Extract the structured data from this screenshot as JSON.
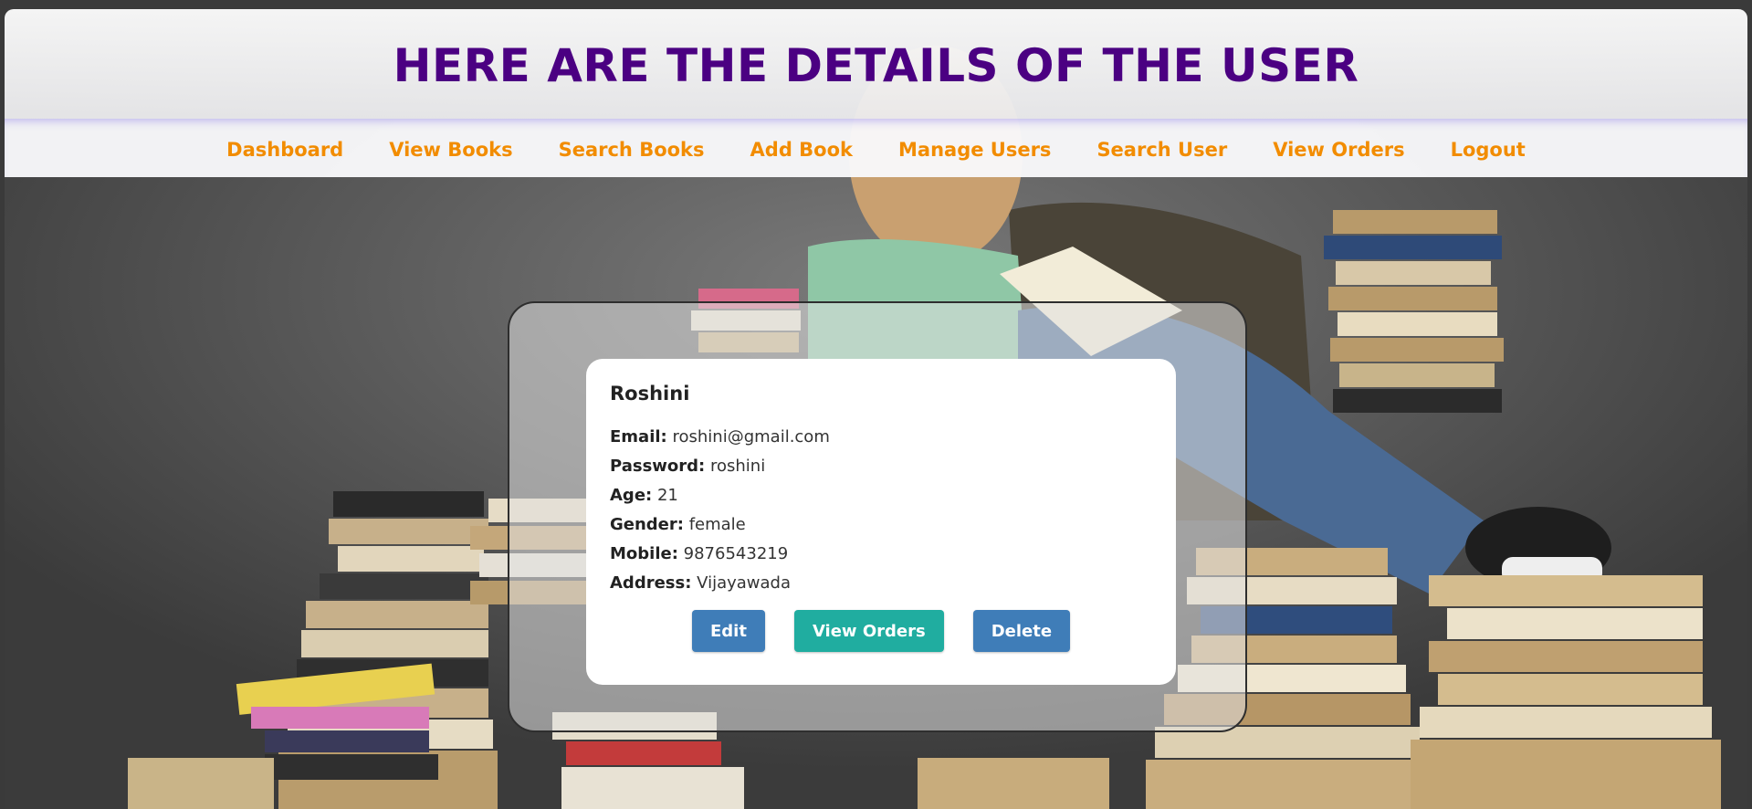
{
  "header": {
    "title": "HERE ARE THE DETAILS OF THE USER"
  },
  "nav": {
    "items": [
      {
        "label": "Dashboard"
      },
      {
        "label": "View Books"
      },
      {
        "label": "Search Books"
      },
      {
        "label": "Add Book"
      },
      {
        "label": "Manage Users"
      },
      {
        "label": "Search User"
      },
      {
        "label": "View Orders"
      },
      {
        "label": "Logout"
      }
    ]
  },
  "user": {
    "name": "Roshini",
    "fields": [
      {
        "label": "Email:",
        "value": "roshini@gmail.com"
      },
      {
        "label": "Password:",
        "value": "roshini"
      },
      {
        "label": "Age:",
        "value": "21"
      },
      {
        "label": "Gender:",
        "value": "female"
      },
      {
        "label": "Mobile:",
        "value": "9876543219"
      },
      {
        "label": "Address:",
        "value": "Vijayawada"
      }
    ]
  },
  "actions": {
    "edit_label": "Edit",
    "orders_label": "View Orders",
    "delete_label": "Delete"
  },
  "colors": {
    "title": "#4b0082",
    "nav_link": "#f28c00",
    "edit_button": "#3f7db8",
    "orders_button": "#20ada0",
    "delete_button": "#3f7db8"
  },
  "background": {
    "icon": "girl-reading-among-books-photo"
  }
}
